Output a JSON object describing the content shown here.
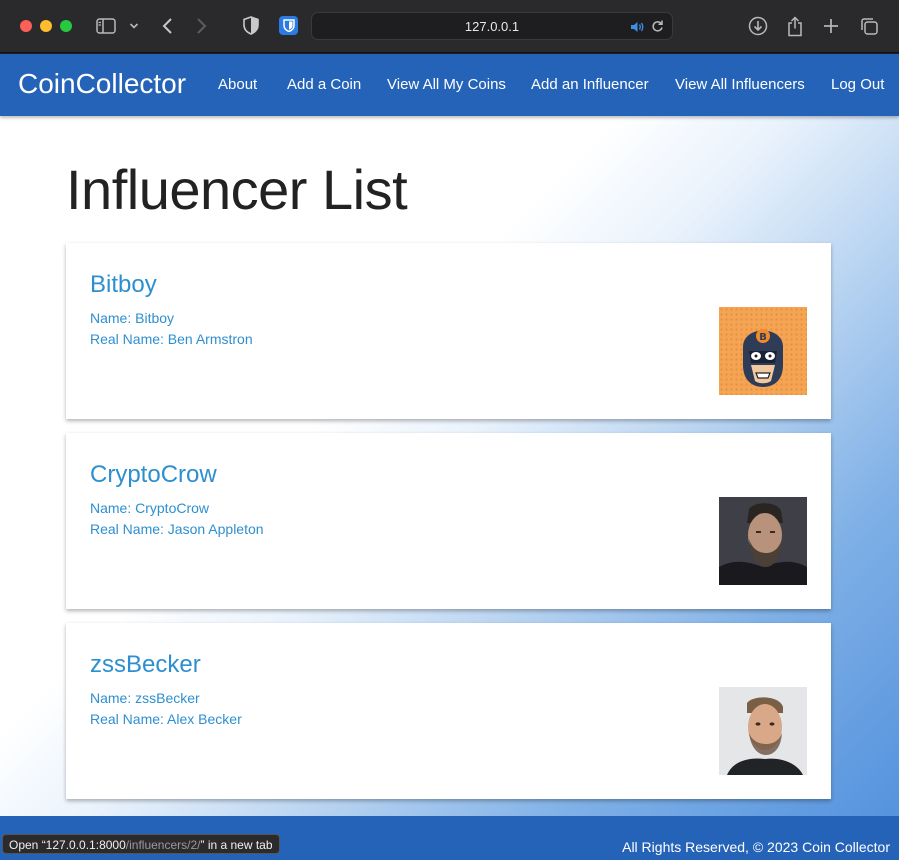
{
  "browser": {
    "url": "127.0.0.1",
    "icons": [
      "sidebar-icon",
      "chevron-down-icon",
      "back-icon",
      "forward-icon",
      "shield-icon",
      "bitwarden-icon",
      "speaker-icon",
      "reload-icon",
      "download-icon",
      "share-icon",
      "new-tab-icon",
      "tabs-icon"
    ]
  },
  "nav": {
    "brand": "CoinCollector",
    "links": [
      "About",
      "Add a Coin",
      "View All My Coins",
      "Add an Influencer",
      "View All Influencers",
      "Log Out"
    ]
  },
  "page": {
    "title": "Influencer List"
  },
  "influencers": [
    {
      "title": "Bitboy",
      "name_line": "Name: Bitboy",
      "real_name_line": "Real Name: Ben Armstron"
    },
    {
      "title": "CryptoCrow",
      "name_line": "Name: CryptoCrow",
      "real_name_line": "Real Name: Jason Appleton"
    },
    {
      "title": "zssBecker",
      "name_line": "Name: zssBecker",
      "real_name_line": "Real Name: Alex Becker"
    }
  ],
  "footer": {
    "text": "All Rights Reserved, © 2023 Coin Collector"
  },
  "status": {
    "prefix": "Open “127.0.0.1:8000",
    "path": "/influencers/2/",
    "suffix": "” in a new tab"
  },
  "colors": {
    "nav": "#2563b8",
    "link": "#2e8fd0"
  }
}
